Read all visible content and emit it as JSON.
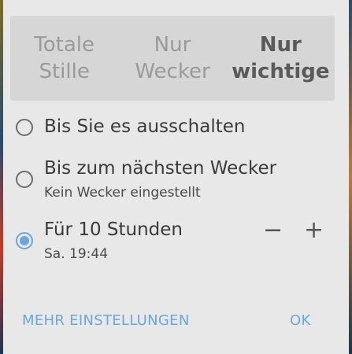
{
  "mode_tabs": [
    {
      "line1": "Totale",
      "line2": "Stille",
      "selected": false
    },
    {
      "line1": "Nur",
      "line2": "Wecker",
      "selected": false
    },
    {
      "line1": "Nur",
      "line2": "wichtige",
      "selected": true
    }
  ],
  "options": [
    {
      "title": "Bis Sie es ausschalten",
      "subtitle": "",
      "checked": false
    },
    {
      "title": "Bis zum nächsten Wecker",
      "subtitle": "Kein Wecker eingestellt",
      "checked": false
    },
    {
      "title": "Für 10 Stunden",
      "subtitle": "Sa. 19:44",
      "checked": true
    }
  ],
  "stepper": {
    "decrease": "−",
    "increase": "+"
  },
  "footer": {
    "more_settings": "MEHR EINSTELLUNGEN",
    "ok": "OK"
  },
  "colors": {
    "accent": "#6aa6df",
    "dialog_bg": "#e8e8e8",
    "tab_bg": "#d6d6d6"
  }
}
